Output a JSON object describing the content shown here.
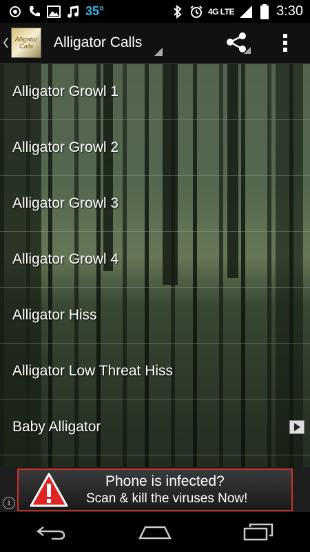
{
  "status_bar": {
    "temperature": "35°",
    "network": "4G LTE",
    "time": "3:30"
  },
  "action_bar": {
    "app_icon_text": "Alligator Calls",
    "title": "Alligator Calls"
  },
  "list": {
    "items": [
      {
        "label": "Alligator Growl 1"
      },
      {
        "label": "Alligator Growl 2"
      },
      {
        "label": "Alligator Growl 3"
      },
      {
        "label": "Alligator Growl 4"
      },
      {
        "label": "Alligator Hiss"
      },
      {
        "label": "Alligator Low Threat Hiss"
      },
      {
        "label": "Baby Alligator"
      }
    ]
  },
  "ad": {
    "line1": "Phone is infected?",
    "line2": "Scan & kill the viruses Now!",
    "info_icon": "i"
  },
  "colors": {
    "accent": "#33b5e5",
    "ad_border": "#c8312a",
    "warning": "#e02424"
  },
  "icons": [
    "notification-target-icon",
    "phone-icon",
    "image-icon",
    "music-icon",
    "bluetooth-icon",
    "alarm-icon",
    "signal-icon",
    "battery-icon",
    "back-arrow-icon",
    "share-icon",
    "overflow-menu-icon",
    "play-icon",
    "warning-icon",
    "info-icon",
    "nav-back-icon",
    "nav-home-icon",
    "nav-recents-icon"
  ]
}
